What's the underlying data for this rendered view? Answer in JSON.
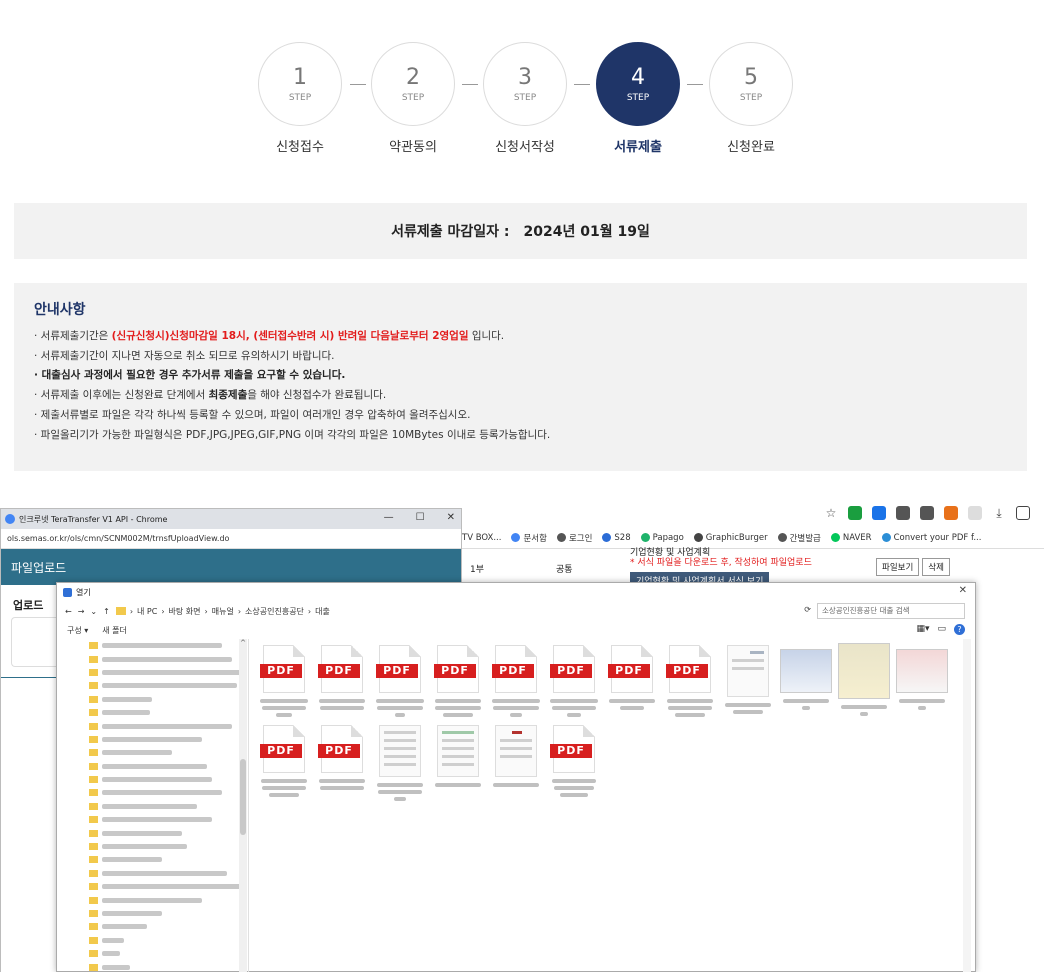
{
  "steps": [
    {
      "num": "1",
      "label": "STEP",
      "name": "신청접수"
    },
    {
      "num": "2",
      "label": "STEP",
      "name": "약관동의"
    },
    {
      "num": "3",
      "label": "STEP",
      "name": "신청서작성"
    },
    {
      "num": "4",
      "label": "STEP",
      "name": "서류제출",
      "active": true
    },
    {
      "num": "5",
      "label": "STEP",
      "name": "신청완료"
    }
  ],
  "deadline": {
    "label": "서류제출 마감일자 :",
    "date": "2024년 01월 19일"
  },
  "notice": {
    "title": "안내사항",
    "line1_pre": "· 서류제출기간은 ",
    "line1_red": "(신규신청시)신청마감일 18시, (센터접수반려 시) 반려일 다음날로부터 2영업일",
    "line1_post": " 입니다.",
    "line2": "· 서류제출기간이 지나면 자동으로 취소 되므로 유의하시기 바랍니다.",
    "line3": "· 대출심사 과정에서 필요한 경우 추가서류 제출을 요구할 수 있습니다.",
    "line4_pre": "· 서류제출 이후에는 신청완료 단계에서 ",
    "line4_bold": "최종제출",
    "line4_post": "을 해야 신청접수가 완료됩니다.",
    "line5": "· 제출서류별로 파일은 각각 하나씩 등록할 수 있으며, 파일이 여러개인 경우 압축하여 올려주십시오.",
    "line6": "· 파일올리기가 가능한 파일형식은 PDF,JPG,JPEG,GIF,PNG 이며 각각의 파일은 10MBytes 이내로 등록가능합니다."
  },
  "bookmarks": [
    "TV BOX...",
    "문서함",
    "로그인",
    "S28",
    "Papago",
    "GraphicBurger",
    "간별발급",
    "NAVER",
    "Convert your PDF f..."
  ],
  "bg_row": {
    "count": "1부",
    "type": "공통",
    "title": "기업현황 및 사업계획",
    "note": "* 서식 파일을 다운로드 후, 작성하여 파일업로드",
    "view_btn": "기업현황 및 사업계획서 서식 보기",
    "file_view": "파일보기",
    "delete": "삭제"
  },
  "popup": {
    "title": "인크루넷 TeraTransfer V1 API - Chrome",
    "url": "ols.semas.or.kr/ols/cmn/SCNM002M/trnsfUploadView.do",
    "header": "파일업로드",
    "side_label": "업로드"
  },
  "dialog": {
    "title": "열기",
    "path": [
      "내 PC",
      "바탕 화면",
      "매뉴얼",
      "소상공인진흥공단",
      "대출"
    ],
    "search_placeholder": "소상공인진흥공단 대출 검색",
    "organize": "구성 ▾",
    "new_folder": "새 폴더",
    "pdf_label": "PDF"
  },
  "colors": {
    "active_step": "#1f3568",
    "pdf_red": "#d71f1f",
    "notice_red": "#e21b1b"
  }
}
